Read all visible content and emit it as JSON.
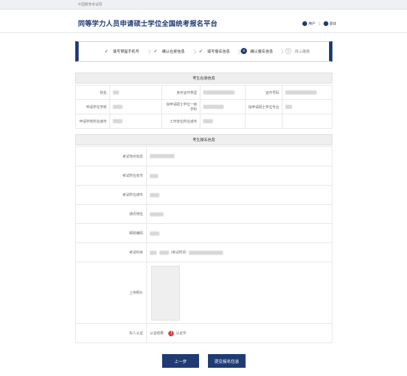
{
  "topbar": {
    "site_name": "中国教育考试网"
  },
  "header": {
    "title": "同等学力人员申请硕士学位全国统考报名平台",
    "user_label": "用户",
    "logout_label": "退出"
  },
  "steps": [
    {
      "label": "填写预留手机号",
      "state": "done"
    },
    {
      "label": "确认在册信息",
      "state": "done"
    },
    {
      "label": "填写报名信息",
      "state": "done"
    },
    {
      "label": "确认报名信息",
      "state": "current",
      "num": "4"
    },
    {
      "label": "网上缴费",
      "state": "todo",
      "num": "5"
    }
  ],
  "registration_section": {
    "title": "考生在册信息",
    "fields": {
      "name": "姓名",
      "id_type": "身份证件类型",
      "id_number": "证件号码",
      "school": "申请学位学校",
      "discipline": "拟申请硕士学位一级学科",
      "major": "拟申请硕士学位专业",
      "school_city": "申请学校所在城市",
      "work_city": "工作单位所在城市"
    }
  },
  "apply_section": {
    "title": "考生报名信息",
    "fields": {
      "exam_site": "考试地点信息",
      "exam_province": "考试所在省市",
      "exam_city": "考试所在城市",
      "address": "通讯地址",
      "postcode": "邮政编码",
      "subject": "考试科目",
      "photo": "上传照片",
      "auth": "实人认证"
    },
    "subject_time_label": "(考试时间:",
    "auth_result_label": "认证结果:",
    "auth_status": "认证中"
  },
  "buttons": {
    "prev": "上一步",
    "submit": "提交报名信息"
  },
  "colors": {
    "primary": "#1f3b73",
    "warning": "#e53935"
  }
}
